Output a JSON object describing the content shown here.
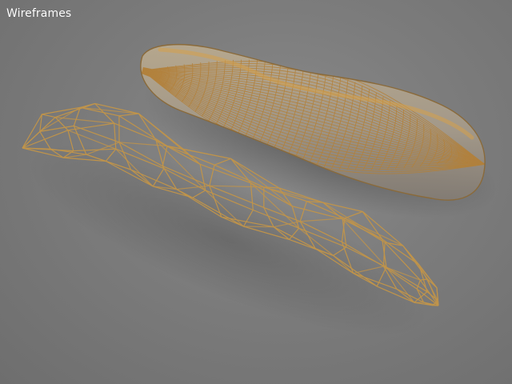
{
  "page": {
    "title": "Wireframes"
  },
  "colors": {
    "background": "#7c7c7c",
    "wire": "#c0944a",
    "dense_wire": "#b3813a",
    "hot_seam": "#d6a04a",
    "title_text": "#ffffff"
  },
  "objects": [
    {
      "name": "dense-baguette-wireframe"
    },
    {
      "name": "low-poly-baguette-wireframe"
    }
  ]
}
